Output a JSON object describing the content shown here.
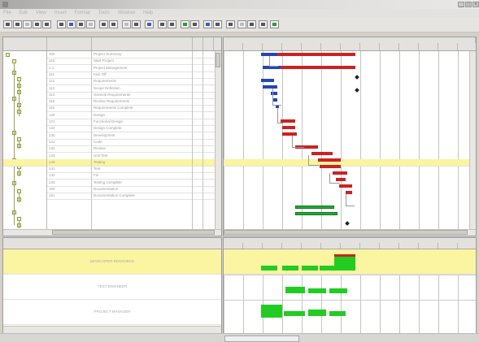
{
  "window": {
    "title": "",
    "controls": [
      "_",
      "□",
      "×"
    ]
  },
  "menu": [
    "File",
    "Edit",
    "View",
    "Insert",
    "Format",
    "Tools",
    "Window",
    "Help"
  ],
  "toolbar": {
    "buttons": [
      "save-icon",
      "print-icon",
      "font-icon",
      "indent-icon",
      "zoom-icon",
      "link-icon",
      "gantt-icon",
      "calendar-icon",
      "filter-icon",
      "sort-icon",
      "task-icon",
      "resource-icon",
      "chart-icon",
      "grid-icon",
      "help-icon"
    ]
  },
  "colors": {
    "highlight": "#fbf4a0",
    "bar_blue": "#2446b8",
    "bar_red": "#cc2222",
    "bar_green": "#22aa33"
  },
  "tasks": [
    {
      "id": "100",
      "name": "Project Summary"
    },
    {
      "id": "110",
      "name": "Start Project"
    },
    {
      "id": "1.1",
      "name": "Project Management"
    },
    {
      "id": "111",
      "name": "Kick Off"
    },
    {
      "id": "112",
      "name": "Requirements"
    },
    {
      "id": "113",
      "name": "Scope Definition"
    },
    {
      "id": "114",
      "name": "General Requirements"
    },
    {
      "id": "115",
      "name": "Review Requirements"
    },
    {
      "id": "116",
      "name": "Requirements Complete"
    },
    {
      "id": "120",
      "name": "Design"
    },
    {
      "id": "121",
      "name": "Functional Design"
    },
    {
      "id": "122",
      "name": "Design Complete"
    },
    {
      "id": "130",
      "name": "Development"
    },
    {
      "id": "131",
      "name": "Code"
    },
    {
      "id": "132",
      "name": "Review"
    },
    {
      "id": "133",
      "name": "Unit Test"
    },
    {
      "id": "140",
      "name": "Testing"
    },
    {
      "id": "141",
      "name": "Test"
    },
    {
      "id": "142",
      "name": "Fix"
    },
    {
      "id": "143",
      "name": "Testing Complete"
    },
    {
      "id": "150",
      "name": "Documentation"
    },
    {
      "id": "151",
      "name": "Documentation Complete"
    }
  ],
  "resources": [
    {
      "name": "DEVELOPER RESOURCE"
    },
    {
      "name": "TEST ENGINEER"
    },
    {
      "name": "PROJECT MANAGER"
    }
  ]
}
